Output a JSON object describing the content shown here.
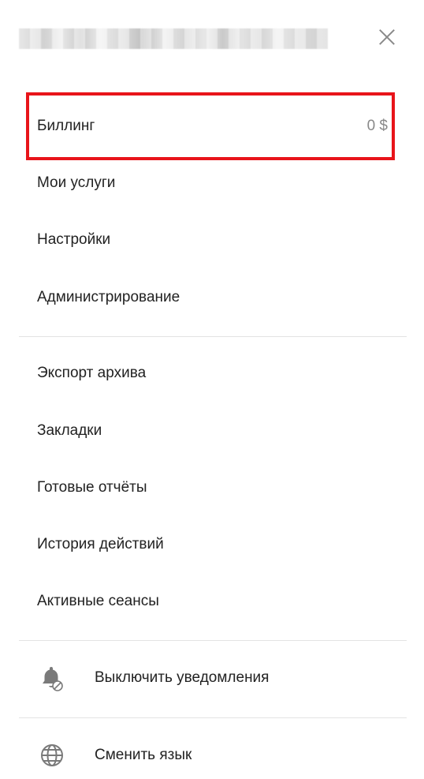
{
  "header": {
    "title_redacted": true,
    "close_icon": "close-icon"
  },
  "menu": {
    "billing": {
      "label": "Биллинг",
      "value": "0 $"
    },
    "my_services": {
      "label": "Мои услуги"
    },
    "settings": {
      "label": "Настройки"
    },
    "administration": {
      "label": "Администрирование"
    },
    "export_archive": {
      "label": "Экспорт архива"
    },
    "bookmarks": {
      "label": "Закладки"
    },
    "ready_reports": {
      "label": "Готовые отчёты"
    },
    "action_history": {
      "label": "История действий"
    },
    "active_sessions": {
      "label": "Активные сеансы"
    },
    "disable_notifications": {
      "label": "Выключить уведомления",
      "icon": "bell-off-icon"
    },
    "change_language": {
      "label": "Сменить язык",
      "icon": "globe-icon"
    }
  },
  "colors": {
    "highlight": "#e8141a",
    "text": "#222222",
    "muted": "#888888",
    "icon": "#7a7a7a",
    "divider": "#e3e3e3"
  }
}
